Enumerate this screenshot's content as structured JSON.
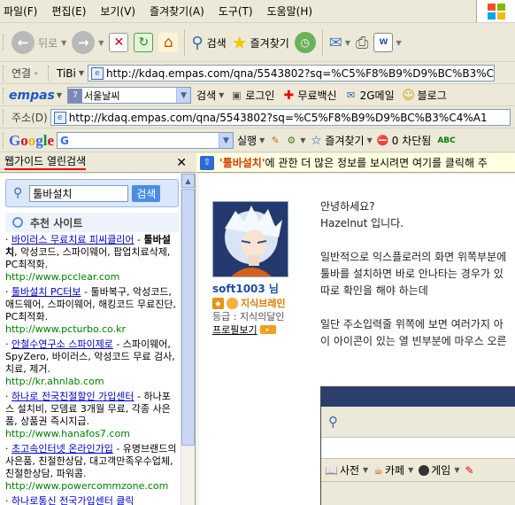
{
  "menu": [
    "파일(F)",
    "편집(E)",
    "보기(V)",
    "즐겨찾기(A)",
    "도구(T)",
    "도움말(H)"
  ],
  "toolbar": {
    "back": "뒤로",
    "search": "검색",
    "favorites": "즐겨찾기"
  },
  "links_bar": {
    "label": "연결",
    "tibi": "TiBi",
    "url": "http://kdaq.empas.com/qna/5543802?sq=%C5%F8%B9%D9%BC%B3%C4%A1"
  },
  "empas_bar": {
    "logo": "empas",
    "location": "서울날씨",
    "search": "검색",
    "login": "로그인",
    "vaccine": "무료백신",
    "mail": "2G메일",
    "blog": "블로그"
  },
  "address_bar": {
    "label": "주소(D)",
    "url": "http://kdaq.empas.com/qna/5543802?sq=%C5%F8%B9%D9%BC%B3%C4%A1"
  },
  "google_bar": {
    "logo": "Google",
    "g": "G",
    "run": "실행",
    "favorites": "즐겨찾기",
    "blocked": "0 차단됨",
    "abc": "ABC"
  },
  "sidebar": {
    "title": "웹가이드 열린검색",
    "close": "✕",
    "search_value": "툴바설치",
    "search_button": "검색",
    "section_title": "추천 사이트",
    "results": [
      {
        "title": "바이러스 무료치료 피씨클리어",
        "desc_bold": "툴바설치",
        "desc": ", 악성코드, 스파이웨어, 팝업치료삭제, PC최적화.",
        "url": "http://www.pcclear.com"
      },
      {
        "title": "툴바설치 PC터보",
        "desc_bold": "",
        "desc": " - 툴바복구, 악성코드, 애드웨어, 스파이웨어, 해킹코드 무료진단, PC최적화.",
        "url": "http://www.pcturbo.co.kr"
      },
      {
        "title": "안철수연구소 스파이제로",
        "desc_bold": "",
        "desc": " - 스파이웨어, SpyZero, 바이러스, 악성코드 무료 검사, 치료, 제거.",
        "url": "http://kr.ahnlab.com"
      },
      {
        "title": "하나로 전국친절할인 가입센터",
        "desc_bold": "",
        "desc": " - 하나포스 설치비, 모뎀료 3개월 무료, 각종 사은품, 상품권 즉시지급.",
        "url": "http://www.hanafos7.com"
      },
      {
        "title": "초고속인터넷 온라인가입",
        "desc_bold": "",
        "desc": " - 유명브랜드의 사은품, 친절한상담, 대고객만족우수업체, 친절한상담, 파워콤.",
        "url": "http://www.powercommzone.com"
      },
      {
        "title": "하나로통신 전국가입센터 클릭",
        "desc_bold": "",
        "desc": "",
        "url": ""
      }
    ]
  },
  "infobar": {
    "quote_open": "'",
    "keyword": "툴바설치",
    "quote_close": "'",
    "text": " 에 관한 더 많은 정보를 보시려면 여기를 클릭해 주"
  },
  "post": {
    "username": "soft1003 님",
    "badge": "지식브레인",
    "grade": "등급 : 지식의달인",
    "profile_link": "프로필보기",
    "lines": [
      "안녕하세요?",
      "Hazelnut 입니다.",
      "",
      "일반적으로 익스플로러의 화면 위쪽부분에",
      "툴바를 설치하면 바로 안나타는 경우가 있",
      "따로 확인을 해야 하는데",
      "",
      "일단 주소입력줄 위쪽에 보면 여러가지 아",
      "이 아이콘이 있는 열 빈부분에 마우스 오른"
    ]
  },
  "embedded": {
    "items": [
      "사전",
      "카페",
      "게임"
    ]
  }
}
